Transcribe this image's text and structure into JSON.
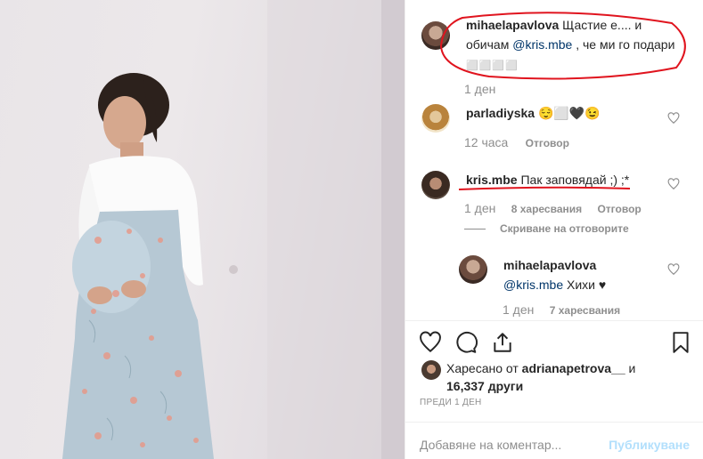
{
  "comments": {
    "caption": {
      "user": "mihaelapavlova",
      "text_part1": "Щастие е.... и",
      "text_part2": "обичам",
      "mention": "@kris.mbe",
      "text_part3": ", че ми го подари",
      "emoji": "⬜⬜⬜⬜",
      "time": "1 ден"
    },
    "comment1": {
      "user": "parladiyska",
      "text": "😌⬜🖤😉",
      "time": "12 часа",
      "reply": "Отговор"
    },
    "comment2": {
      "user": "kris.mbe",
      "text": "Пак заповядай ;) ;*",
      "time": "1 ден",
      "likes": "8 харесвания",
      "reply": "Отговор",
      "hide_replies": "Скриване на отговорите"
    },
    "reply1": {
      "user": "mihaelapavlova",
      "mention": "@kris.mbe",
      "text": "Хихи ♥",
      "time": "1 ден",
      "likes": "7 харесвания"
    }
  },
  "likes": {
    "prefix": "Харесано от",
    "user": "adrianapetrova__",
    "conj": "и",
    "count": "16,337 други"
  },
  "ago": "ПРЕДИ 1 ДЕН",
  "add_comment": {
    "placeholder": "Добавяне на коментар...",
    "publish": "Публикуване"
  },
  "colors": {
    "annotation_red": "#e0141e",
    "publish_disabled": "#b2dffc",
    "mention": "#003569"
  }
}
